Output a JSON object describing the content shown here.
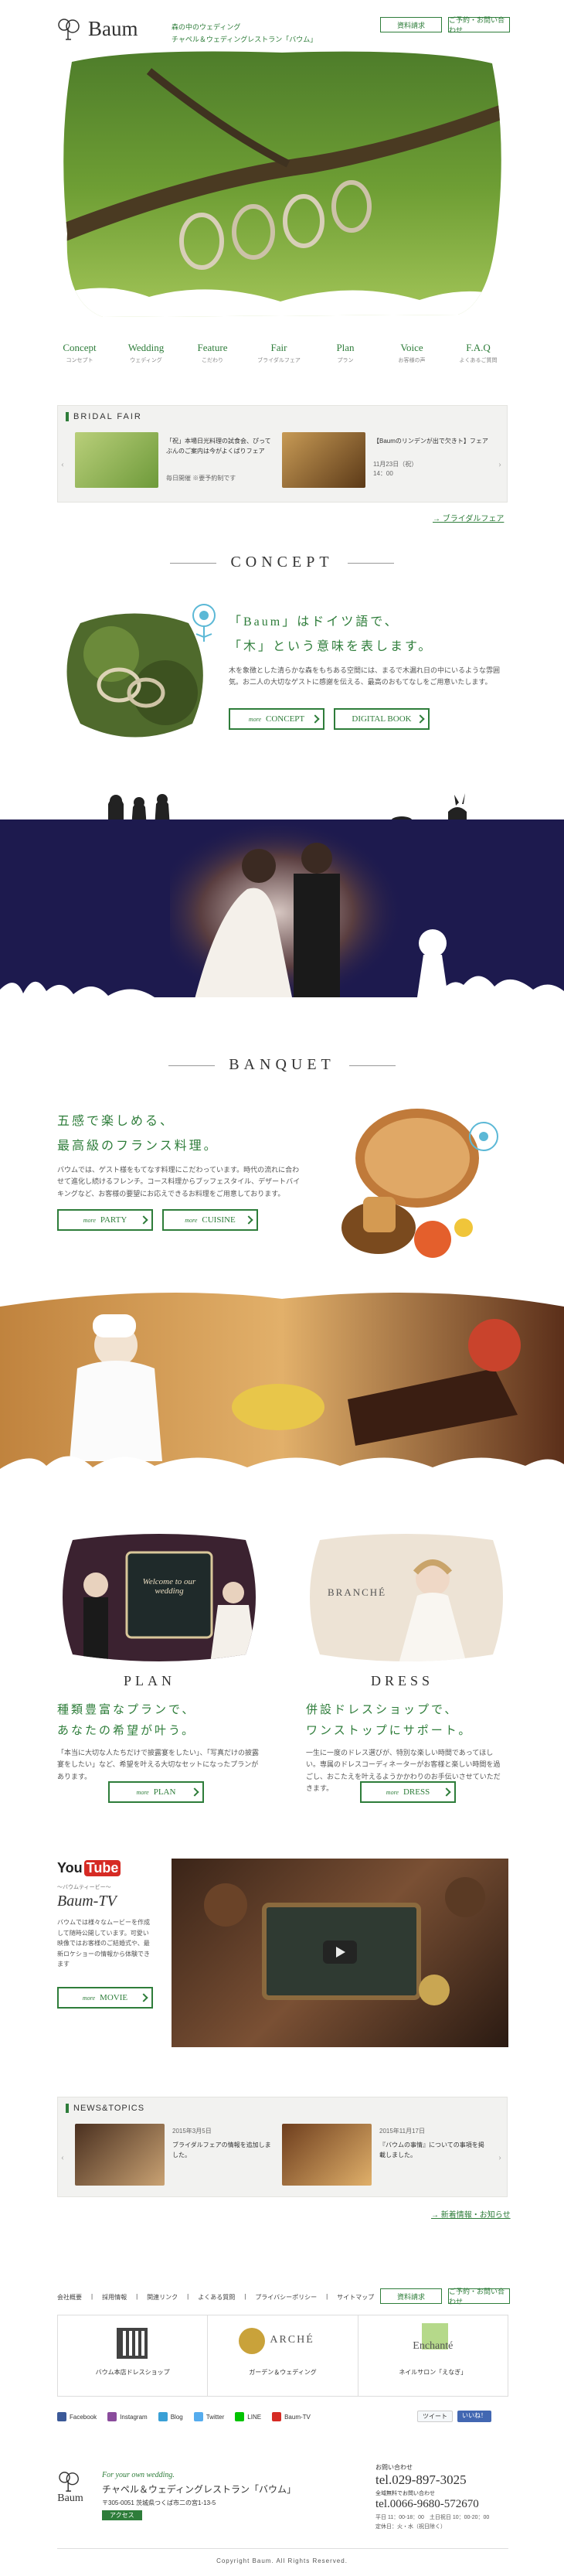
{
  "header": {
    "logo_text": "Baum",
    "tagline_1": "森の中のウェディング",
    "tagline_2": "チャペル＆ウェディングレストラン「バウム」",
    "btn_info": "資料請求",
    "btn_reserve": "ご予約・お問い合わせ"
  },
  "nav": [
    {
      "en": "Concept",
      "jp": "コンセプト"
    },
    {
      "en": "Wedding",
      "jp": "ウェディング"
    },
    {
      "en": "Feature",
      "jp": "こだわり"
    },
    {
      "en": "Fair",
      "jp": "ブライダルフェア"
    },
    {
      "en": "Plan",
      "jp": "プラン"
    },
    {
      "en": "Voice",
      "jp": "お客様の声"
    },
    {
      "en": "F.A.Q",
      "jp": "よくあるご質問"
    }
  ],
  "fair": {
    "title": "BRIDAL FAIR",
    "item1_text": "「祝」本場日光料理の試食会、ぴってぶんのご案内は今がよくばりフェア",
    "item1_date": "毎日開催 ※要予約制です",
    "item2_text": "【Baumのリンデンが出で欠きト】フェア",
    "item2_date": "11月23日（祝）",
    "item2_date2": "14：00",
    "more": "→ ブライダルフェア"
  },
  "concept": {
    "title": "CONCEPT",
    "catch_1": "「Baum」はドイツ語で、",
    "catch_2": "「木」という意味を表します。",
    "body": "木を象徴とした清らかな森をもちある空間には、まるで木漏れ日の中にいるような雰囲気。お二人の大切なゲストに感謝を伝える、最高のおもてなしをご用意いたします。",
    "btn_concept": "CONCEPT",
    "btn_digital": "DIGITAL BOOK",
    "more": "more"
  },
  "banquet": {
    "title": "BANQUET",
    "catch_1": "五感で楽しめる、",
    "catch_2": "最高級のフランス料理。",
    "body": "バウムでは、ゲスト様をもてなす料理にこだわっています。時代の流れに合わせて進化し続けるフレンチ。コース料理からブッフェスタイル、デザートバイキングなど、お客様の要望にお応えできるお料理をご用意しております。",
    "btn_party": "PARTY",
    "btn_cuisine": "CUISINE",
    "more": "more"
  },
  "plan": {
    "title": "PLAN",
    "catch_1": "種類豊富なプランで、",
    "catch_2": "あなたの希望が叶う。",
    "body": "「本当に大切な人たちだけで披露宴をしたい」、「写真だけの披露宴をしたい」など、希望を叶える大切なセットになったプランがあります。",
    "btn": "PLAN",
    "more": "more",
    "board_text": "Welcome to our wedding"
  },
  "dress": {
    "title": "DRESS",
    "catch_1": "併設ドレスショップで、",
    "catch_2": "ワンストップにサポート。",
    "body": "一生に一度のドレス選びが、特別な楽しい時間であってほしい。専属のドレスコーディネーターがお客様と楽しい時間を過ごし、おこたえを叶えるようかかわりのお手伝いさせていただきます。",
    "btn": "DRESS",
    "more": "more",
    "shop_name": "BRANCHÉ"
  },
  "youtube": {
    "logo_you": "You",
    "logo_tube": "Tube",
    "sub": "～バウムティービー～",
    "title": "Baum-TV",
    "body": "バウムでは様々なムービーを作成して随時公開しています。可愛い映像ではお客様のご結婚式や、最新ロケショーの情報から体験できます",
    "btn": "MOVIE",
    "more": "more"
  },
  "news": {
    "title": "NEWS&TOPICS",
    "item1_date": "2015年3月5日",
    "item1_text": "ブライダルフェアの情報を追加しました。",
    "item2_date": "2015年11月17日",
    "item2_text": "『バウムの事情』についての事項を掲載しました。",
    "more": "→ 新着情報・お知らせ"
  },
  "footer": {
    "links": [
      "会社概要",
      "採用情報",
      "関連リンク",
      "よくある質問",
      "プライバシーポリシー",
      "サイトマップ"
    ],
    "btn_info": "資料請求",
    "btn_reserve": "ご予約・お問い合わせ",
    "banner1_label": "バウム本店ドレスショップ",
    "banner2_name": "ARCHÉ",
    "banner2_label": "ガーデン＆ウェディング",
    "banner3_name": "Enchanté",
    "banner3_label": "ネイルサロン「えなぎ」",
    "social": [
      "Facebook",
      "Instagram",
      "Blog",
      "Twitter",
      "LINE",
      "Baum-TV"
    ],
    "tweet": "ツイート",
    "like": "いいね！",
    "catch": "For your own wedding.",
    "name": "チャペル＆ウェディングレストラン「バウム」",
    "address": "〒305-0051 茨城県つくば市二の宮1-13-5",
    "access_label": "アクセス",
    "contact_label": "お問い合わせ",
    "tel1": "tel.029-897-3025",
    "contact_label_2": "全域無料でお問い合わせ",
    "tel2": "tel.0066-9680-572670",
    "hours_1": "平日 11：00-18：00　土日祝日 10：00-20：00",
    "hours_2": "定休日：火・水（祝日除く）",
    "copyright": "Copyright Baum. All Rights Reserved."
  },
  "colors": {
    "accent": "#2e7d3a",
    "night": "#1d1a4e"
  }
}
